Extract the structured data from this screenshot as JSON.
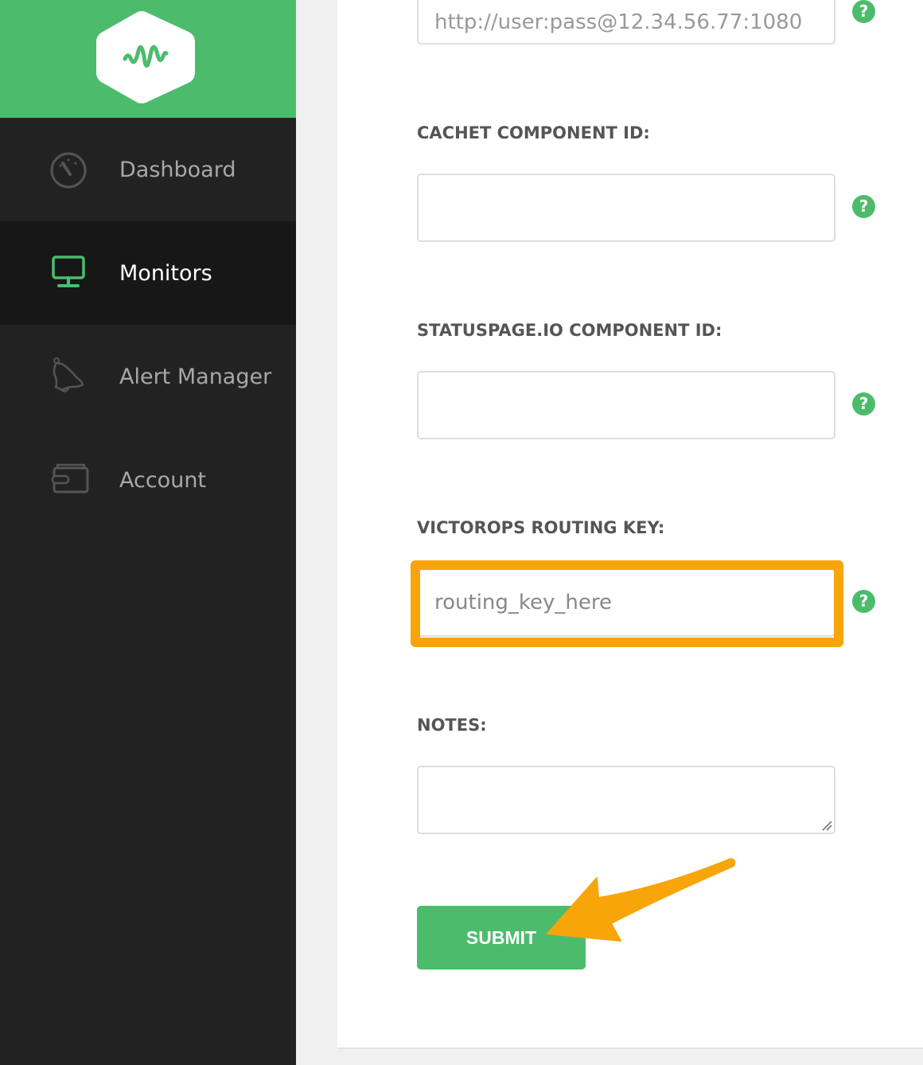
{
  "sidebar": {
    "items": [
      {
        "label": "Dashboard",
        "icon": "dashboard-gauge-icon"
      },
      {
        "label": "Monitors",
        "icon": "monitor-icon",
        "active": true
      },
      {
        "label": "Alert Manager",
        "icon": "bell-icon"
      },
      {
        "label": "Account",
        "icon": "wallet-icon"
      }
    ]
  },
  "form": {
    "proxy_value": "http://user:pass@12.34.56.77:1080",
    "cachet_label": "CACHET COMPONENT ID:",
    "cachet_value": "",
    "statuspage_label": "STATUSPAGE.IO COMPONENT ID:",
    "statuspage_value": "",
    "victorops_label": "VICTOROPS ROUTING KEY:",
    "victorops_value": "routing_key_here",
    "notes_label": "NOTES:",
    "notes_value": "",
    "help_glyph": "?",
    "submit_label": "SUBMIT"
  },
  "colors": {
    "brand": "#4cbc6c",
    "highlight": "#f8a50a",
    "sidebar": "#222222"
  }
}
